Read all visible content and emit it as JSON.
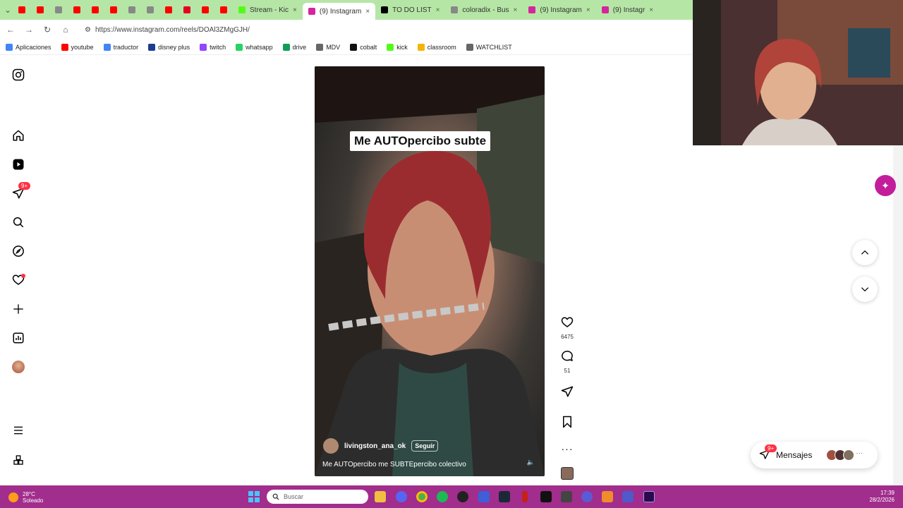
{
  "browser": {
    "tabs": [
      {
        "label": "",
        "fav": "#ff0000"
      },
      {
        "label": "",
        "fav": "#ff0000"
      },
      {
        "label": "",
        "fav": "#888888"
      },
      {
        "label": "",
        "fav": "#ff0000"
      },
      {
        "label": "",
        "fav": "#ff0000"
      },
      {
        "label": "",
        "fav": "#ff0000"
      },
      {
        "label": "",
        "fav": "#888888"
      },
      {
        "label": "",
        "fav": "#888888"
      },
      {
        "label": "",
        "fav": "#ff0000"
      },
      {
        "label": "",
        "fav": "#e60023"
      },
      {
        "label": "",
        "fav": "#ff0000"
      },
      {
        "label": "",
        "fav": "#ff0000"
      },
      {
        "label": "Stream - Kic",
        "fav": "#53fc18"
      },
      {
        "label": "(9) Instagram",
        "fav": "#d6249f",
        "active": true
      },
      {
        "label": "TO DO LIST",
        "fav": "#000000"
      },
      {
        "label": "coloradix - Bus",
        "fav": "#888888"
      },
      {
        "label": "(9) Instagram",
        "fav": "#d6249f"
      },
      {
        "label": "(9) Instagr",
        "fav": "#d6249f"
      }
    ],
    "url": "https://www.instagram.com/reels/DOAl3ZMgGJH/",
    "bookmarks": [
      "Aplicaciones",
      "youtube",
      "traductor",
      "disney plus",
      "twitch",
      "whatsapp",
      "drive",
      "MDV",
      "cobalt",
      "kick",
      "classroom",
      "WATCHLIST"
    ]
  },
  "sidebar": {
    "notifications_badge": "9+"
  },
  "reel": {
    "overlay_text": "Me AUTOpercibo subte",
    "username": "livingston_ana_ok",
    "follow_label": "Seguir",
    "description": "Me AUTOpercibo me SUBTEpercibo colectivo"
  },
  "actions": {
    "likes": "6475",
    "comments": "51"
  },
  "messages": {
    "label": "Mensajes",
    "badge": "9+"
  },
  "taskbar": {
    "temperature": "28°C",
    "weather": "Soleado",
    "search_placeholder": "Buscar",
    "time": "17:39",
    "date": "28/2/2026"
  }
}
